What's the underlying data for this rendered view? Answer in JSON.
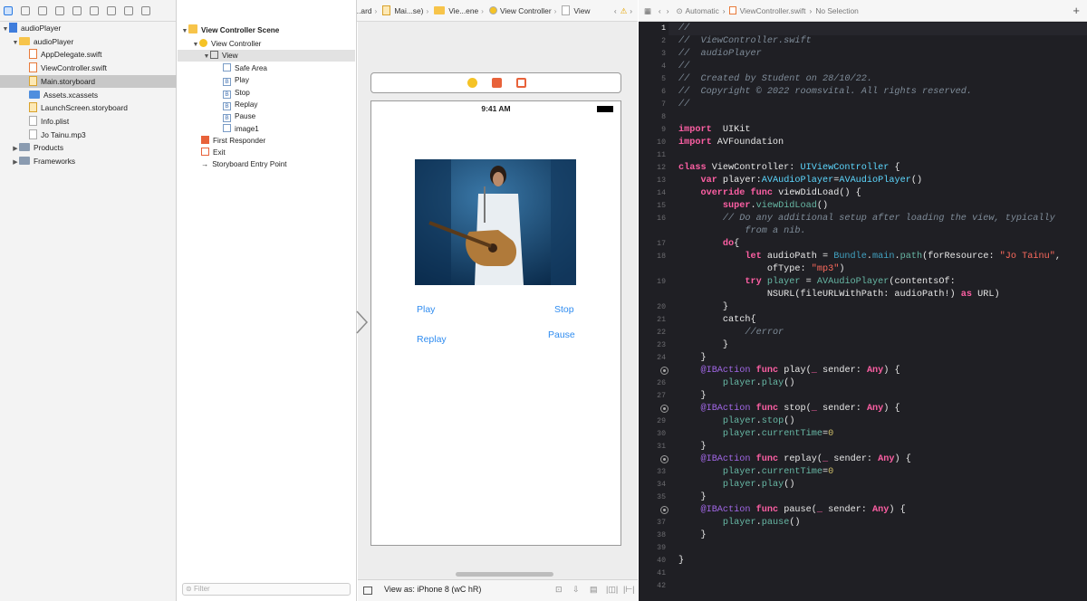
{
  "navigator": {
    "items": [
      {
        "label": "audioPlayer",
        "kind": "project",
        "level": 0,
        "open": true
      },
      {
        "label": "audioPlayer",
        "kind": "folder",
        "level": 1,
        "open": true
      },
      {
        "label": "AppDelegate.swift",
        "kind": "swift",
        "level": 2
      },
      {
        "label": "ViewController.swift",
        "kind": "swift",
        "level": 2
      },
      {
        "label": "Main.storyboard",
        "kind": "storyboard",
        "level": 2,
        "selected": true
      },
      {
        "label": "Assets.xcassets",
        "kind": "assets",
        "level": 2
      },
      {
        "label": "LaunchScreen.storyboard",
        "kind": "storyboard",
        "level": 2
      },
      {
        "label": "Info.plist",
        "kind": "plist",
        "level": 2
      },
      {
        "label": "Jo Tainu.mp3",
        "kind": "audio",
        "level": 2
      },
      {
        "label": "Products",
        "kind": "folder",
        "level": 1,
        "open": false
      },
      {
        "label": "Frameworks",
        "kind": "folder",
        "level": 1,
        "open": false
      }
    ]
  },
  "ib_breadcrumb": [
    "audioPlayer",
    "au...ayer",
    "Mai...ard",
    "Mai...se)",
    "Vie...ene",
    "View Controller",
    "View"
  ],
  "outline": {
    "scene": "View Controller Scene",
    "controller": "View Controller",
    "view": "View",
    "children": [
      "Safe Area",
      "Play",
      "Stop",
      "Replay",
      "Pause",
      "image1"
    ],
    "first_responder": "First Responder",
    "exit": "Exit",
    "entry_point": "Storyboard Entry Point"
  },
  "filter_placeholder": "Filter",
  "canvas": {
    "time": "9:41 AM",
    "buttons": {
      "play": "Play",
      "stop": "Stop",
      "replay": "Replay",
      "pause": "Pause"
    },
    "view_as": "View as: iPhone 8 (wC hR)"
  },
  "editor_bar": {
    "automatic": "Automatic",
    "file": "ViewController.swift",
    "selection": "No Selection"
  },
  "code": [
    {
      "n": 1,
      "t": [
        [
          "cm",
          "//"
        ]
      ]
    },
    {
      "n": 2,
      "t": [
        [
          "cm",
          "//  ViewController.swift"
        ]
      ]
    },
    {
      "n": 3,
      "t": [
        [
          "cm",
          "//  audioPlayer"
        ]
      ]
    },
    {
      "n": 4,
      "t": [
        [
          "cm",
          "//"
        ]
      ]
    },
    {
      "n": 5,
      "t": [
        [
          "cm",
          "//  Created by Student on 28/10/22."
        ]
      ]
    },
    {
      "n": 6,
      "t": [
        [
          "cm",
          "//  Copyright © 2022 roomsvital. All rights reserved."
        ]
      ]
    },
    {
      "n": 7,
      "t": [
        [
          "cm",
          "//"
        ]
      ]
    },
    {
      "n": 8,
      "t": []
    },
    {
      "n": 9,
      "t": [
        [
          "kw",
          "import"
        ],
        [
          "",
          "  UIKit"
        ]
      ]
    },
    {
      "n": 10,
      "t": [
        [
          "kw",
          "import"
        ],
        [
          "",
          " AVFoundation"
        ]
      ]
    },
    {
      "n": 11,
      "t": []
    },
    {
      "n": 12,
      "t": [
        [
          "kw",
          "class"
        ],
        [
          "",
          " ViewController: "
        ],
        [
          "ty",
          "UIViewController"
        ],
        [
          "",
          " {"
        ]
      ]
    },
    {
      "n": 13,
      "t": [
        [
          "",
          "    "
        ],
        [
          "kw",
          "var"
        ],
        [
          "",
          " player:"
        ],
        [
          "ty",
          "AVAudioPlayer"
        ],
        [
          "",
          "="
        ],
        [
          "ty",
          "AVAudioPlayer"
        ],
        [
          "",
          "()"
        ]
      ]
    },
    {
      "n": 14,
      "t": [
        [
          "",
          "    "
        ],
        [
          "kw",
          "override func"
        ],
        [
          "",
          " viewDidLoad() {"
        ]
      ]
    },
    {
      "n": 15,
      "t": [
        [
          "",
          "        "
        ],
        [
          "kw",
          "super"
        ],
        [
          "",
          "."
        ],
        [
          "fn",
          "viewDidLoad"
        ],
        [
          "",
          "()"
        ]
      ]
    },
    {
      "n": 16,
      "t": [
        [
          "",
          "        "
        ],
        [
          "cm",
          "// Do any additional setup after loading the view, typically"
        ]
      ]
    },
    {
      "n": null,
      "t": [
        [
          "",
          "            "
        ],
        [
          "cm",
          "from a nib."
        ]
      ]
    },
    {
      "n": 17,
      "t": [
        [
          "",
          "        "
        ],
        [
          "kw",
          "do"
        ],
        [
          "",
          "{"
        ]
      ]
    },
    {
      "n": 18,
      "t": [
        [
          "",
          "            "
        ],
        [
          "kw",
          "let"
        ],
        [
          "",
          " audioPath = "
        ],
        [
          "pr",
          "Bundle"
        ],
        [
          "",
          "."
        ],
        [
          "pr",
          "main"
        ],
        [
          "",
          "."
        ],
        [
          "fn",
          "path"
        ],
        [
          "",
          "(forResource: "
        ],
        [
          "st",
          "\"Jo Tainu\""
        ],
        [
          "",
          ","
        ]
      ]
    },
    {
      "n": null,
      "t": [
        [
          "",
          "                ofType: "
        ],
        [
          "st",
          "\"mp3\""
        ],
        [
          "",
          ")"
        ]
      ]
    },
    {
      "n": 19,
      "t": [
        [
          "",
          "            "
        ],
        [
          "kw",
          "try"
        ],
        [
          "",
          " "
        ],
        [
          "fn",
          "player"
        ],
        [
          "",
          " = "
        ],
        [
          "fn",
          "AVAudioPlayer"
        ],
        [
          "",
          "(contentsOf:"
        ]
      ]
    },
    {
      "n": null,
      "t": [
        [
          "",
          "                NSURL(fileURLWithPath: audioPath!) "
        ],
        [
          "kw",
          "as"
        ],
        [
          "",
          " URL)"
        ]
      ]
    },
    {
      "n": 20,
      "t": [
        [
          "",
          "        }"
        ]
      ]
    },
    {
      "n": 21,
      "t": [
        [
          "",
          "        catch{"
        ]
      ]
    },
    {
      "n": 22,
      "t": [
        [
          "",
          "            "
        ],
        [
          "cm",
          "//error"
        ]
      ]
    },
    {
      "n": 23,
      "t": [
        [
          "",
          "        }"
        ]
      ]
    },
    {
      "n": 24,
      "t": [
        [
          "",
          "    }"
        ]
      ]
    },
    {
      "n": 25,
      "bp": true,
      "t": [
        [
          "",
          "    "
        ],
        [
          "pl",
          "@IBAction"
        ],
        [
          "",
          " "
        ],
        [
          "kw",
          "func"
        ],
        [
          "",
          " play("
        ],
        [
          "kw",
          "_"
        ],
        [
          "",
          " sender: "
        ],
        [
          "kw",
          "Any"
        ],
        [
          "",
          ") {"
        ]
      ]
    },
    {
      "n": 26,
      "t": [
        [
          "",
          "        "
        ],
        [
          "fn",
          "player"
        ],
        [
          "",
          "."
        ],
        [
          "fn",
          "play"
        ],
        [
          "",
          "()"
        ]
      ]
    },
    {
      "n": 27,
      "t": [
        [
          "",
          "    }"
        ]
      ]
    },
    {
      "n": 28,
      "bp": true,
      "t": [
        [
          "",
          "    "
        ],
        [
          "pl",
          "@IBAction"
        ],
        [
          "",
          " "
        ],
        [
          "kw",
          "func"
        ],
        [
          "",
          " stop("
        ],
        [
          "kw",
          "_"
        ],
        [
          "",
          " sender: "
        ],
        [
          "kw",
          "Any"
        ],
        [
          "",
          ") {"
        ]
      ]
    },
    {
      "n": 29,
      "t": [
        [
          "",
          "        "
        ],
        [
          "fn",
          "player"
        ],
        [
          "",
          "."
        ],
        [
          "fn",
          "stop"
        ],
        [
          "",
          "()"
        ]
      ]
    },
    {
      "n": 30,
      "t": [
        [
          "",
          "        "
        ],
        [
          "fn",
          "player"
        ],
        [
          "",
          "."
        ],
        [
          "fn",
          "currentTime"
        ],
        [
          "",
          "="
        ],
        [
          "nu",
          "0"
        ]
      ]
    },
    {
      "n": 31,
      "t": [
        [
          "",
          "    }"
        ]
      ]
    },
    {
      "n": 32,
      "bp": true,
      "t": [
        [
          "",
          "    "
        ],
        [
          "pl",
          "@IBAction"
        ],
        [
          "",
          " "
        ],
        [
          "kw",
          "func"
        ],
        [
          "",
          " replay("
        ],
        [
          "kw",
          "_"
        ],
        [
          "",
          " sender: "
        ],
        [
          "kw",
          "Any"
        ],
        [
          "",
          ") {"
        ]
      ]
    },
    {
      "n": 33,
      "t": [
        [
          "",
          "        "
        ],
        [
          "fn",
          "player"
        ],
        [
          "",
          "."
        ],
        [
          "fn",
          "currentTime"
        ],
        [
          "",
          "="
        ],
        [
          "nu",
          "0"
        ]
      ]
    },
    {
      "n": 34,
      "t": [
        [
          "",
          "        "
        ],
        [
          "fn",
          "player"
        ],
        [
          "",
          "."
        ],
        [
          "fn",
          "play"
        ],
        [
          "",
          "()"
        ]
      ]
    },
    {
      "n": 35,
      "t": [
        [
          "",
          "    }"
        ]
      ]
    },
    {
      "n": 36,
      "bp": true,
      "t": [
        [
          "",
          "    "
        ],
        [
          "pl",
          "@IBAction"
        ],
        [
          "",
          " "
        ],
        [
          "kw",
          "func"
        ],
        [
          "",
          " pause("
        ],
        [
          "kw",
          "_"
        ],
        [
          "",
          " sender: "
        ],
        [
          "kw",
          "Any"
        ],
        [
          "",
          ") {"
        ]
      ]
    },
    {
      "n": 37,
      "t": [
        [
          "",
          "        "
        ],
        [
          "fn",
          "player"
        ],
        [
          "",
          "."
        ],
        [
          "fn",
          "pause"
        ],
        [
          "",
          "()"
        ]
      ]
    },
    {
      "n": 38,
      "t": [
        [
          "",
          "    }"
        ]
      ]
    },
    {
      "n": 39,
      "t": []
    },
    {
      "n": 40,
      "t": [
        [
          "",
          "}"
        ]
      ]
    },
    {
      "n": 41,
      "t": []
    },
    {
      "n": 42,
      "t": []
    }
  ]
}
